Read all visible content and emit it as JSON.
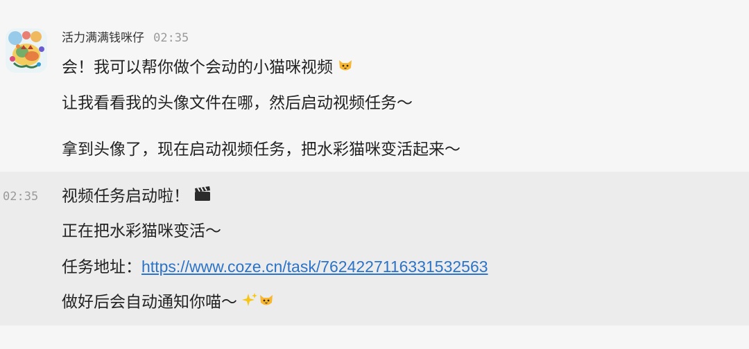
{
  "message_group": {
    "sender_name": "活力满满钱咪仔",
    "timestamp": "02:35",
    "avatar_icon": "watercolor-cat-avatar",
    "lines": [
      "会！我可以帮你做个会动的小猫咪视频",
      "让我看看我的头像文件在哪，然后启动视频任务～",
      "拿到头像了，现在启动视频任务，把水彩猫咪变活起来～"
    ]
  },
  "followup_message": {
    "timestamp": "02:35",
    "lines": [
      "视频任务启动啦！",
      "正在把水彩猫咪变活～",
      "做好后会自动通知你喵～"
    ],
    "task_label": "任务地址：",
    "task_url": "https://www.coze.cn/task/7624227116331532563"
  },
  "icons": {
    "cat_emoji": "cat-face-icon",
    "clapper_emoji": "clapper-board-icon",
    "sparkles_emoji": "sparkles-icon"
  },
  "colors": {
    "background": "#f6f6f6",
    "hover_background": "#ececec",
    "link": "#2a73c8",
    "timestamp": "#9a9a9a"
  }
}
